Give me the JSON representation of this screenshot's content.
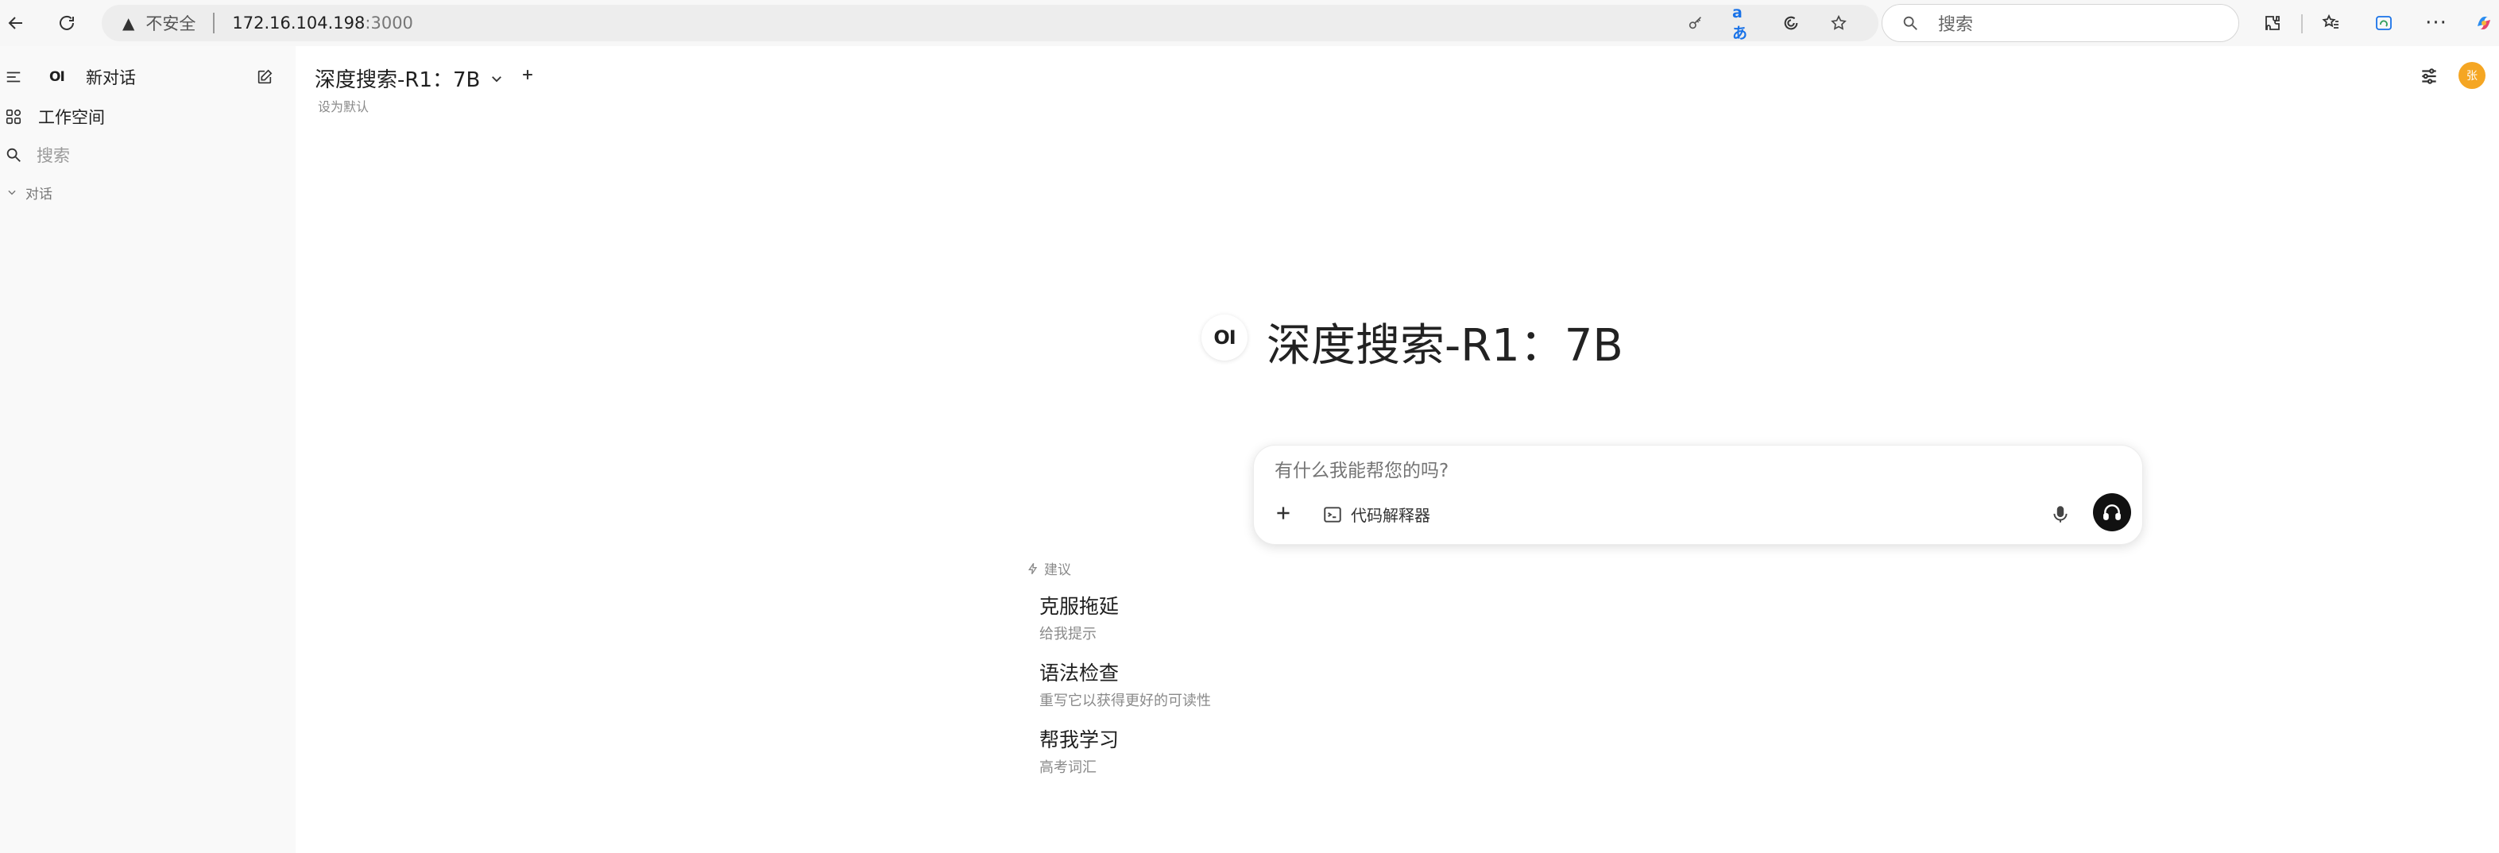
{
  "browser": {
    "security_label": "不安全",
    "url_host": "172.16.104.198",
    "url_port": ":3000",
    "search_placeholder": "搜索",
    "translate_glyph": "aあ"
  },
  "sidebar": {
    "logo_text": "OI",
    "new_chat_label": "新对话",
    "workspace_label": "工作空间",
    "search_placeholder": "搜索",
    "section_label": "对话"
  },
  "header": {
    "model_name": "深度搜索-R1：7B",
    "set_default_label": "设为默认",
    "avatar_letter": "张"
  },
  "hero": {
    "logo_text": "OI",
    "title": "深度搜索-R1：7B"
  },
  "composer": {
    "placeholder": "有什么我能帮您的吗?",
    "code_interpreter_label": "代码解释器"
  },
  "suggestions": {
    "heading": "建议",
    "items": [
      {
        "title": "克服拖延",
        "subtitle": "给我提示"
      },
      {
        "title": "语法检查",
        "subtitle": "重写它以获得更好的可读性"
      },
      {
        "title": "帮我学习",
        "subtitle": "高考词汇"
      }
    ]
  },
  "colors": {
    "avatar_bg": "#f5a623",
    "sidebar_bg": "#f9f9f9",
    "send_button_bg": "#111111"
  }
}
